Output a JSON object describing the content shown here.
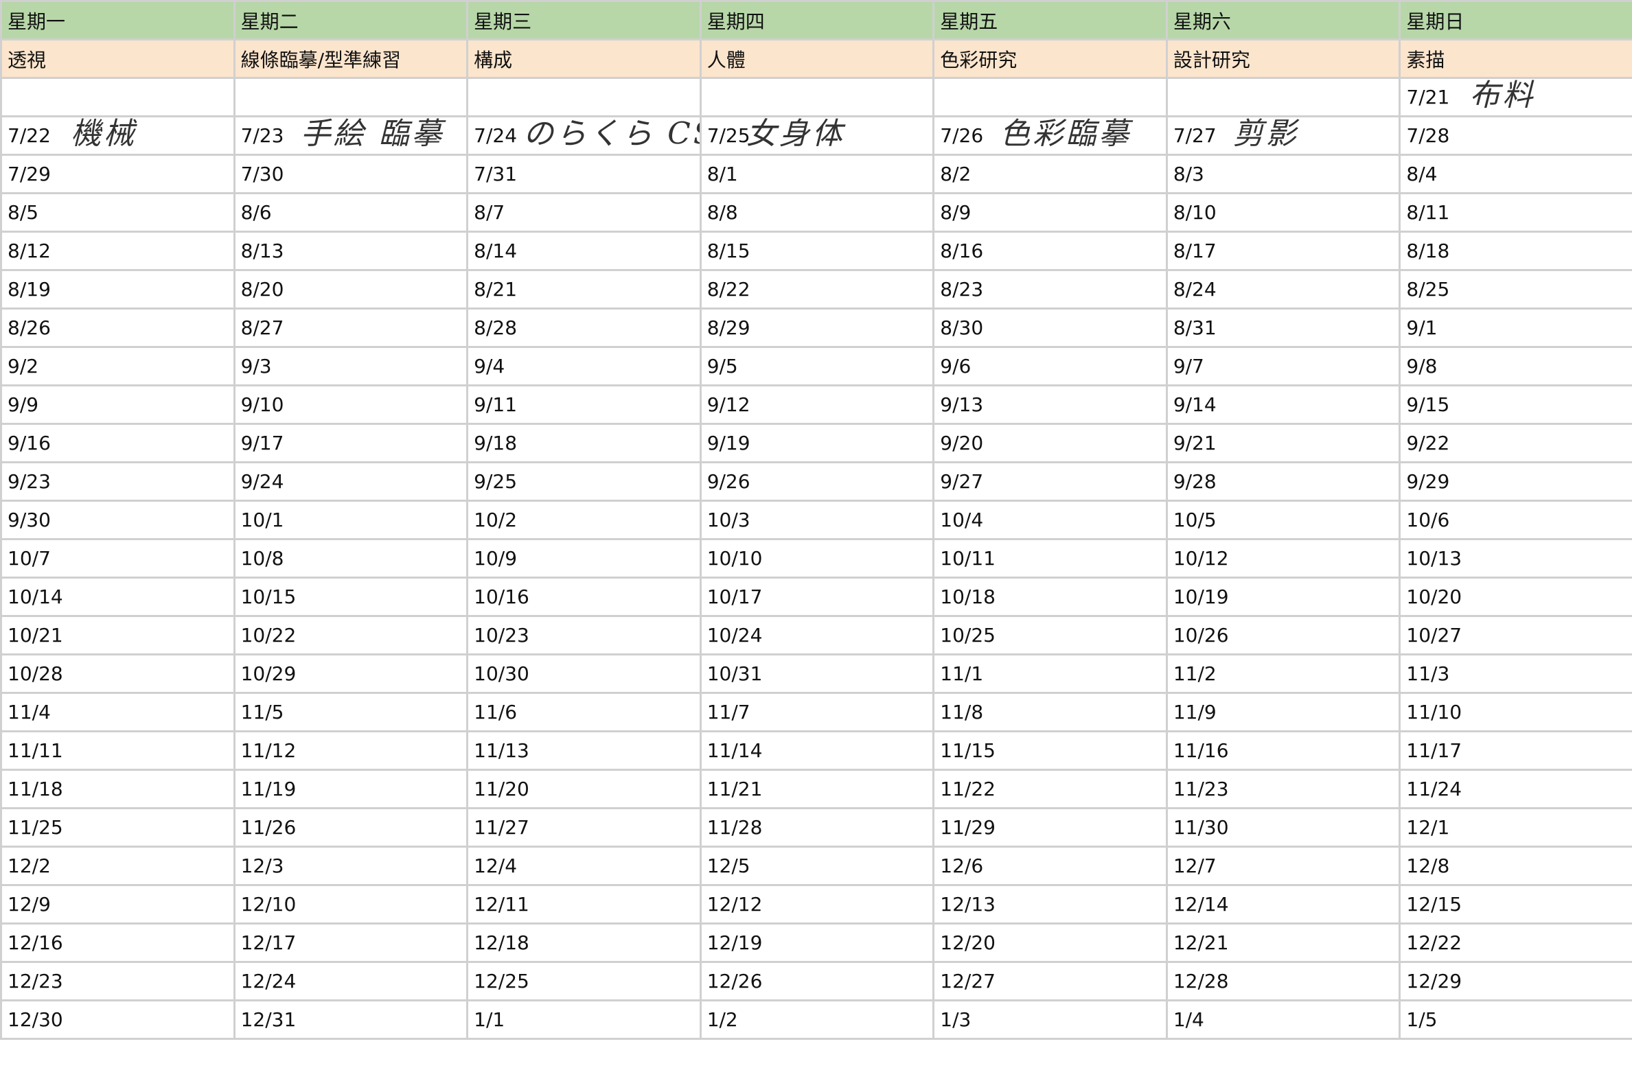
{
  "weekdays": [
    "星期一",
    "星期二",
    "星期三",
    "星期四",
    "星期五",
    "星期六",
    "星期日"
  ],
  "subjects": [
    "透視",
    "線條臨摹/型準練習",
    "構成",
    "人體",
    "色彩研究",
    "設計研究",
    "素描"
  ],
  "rows": [
    [
      "",
      "",
      "",
      "",
      "",
      "",
      "7/21"
    ],
    [
      "7/22",
      "7/23",
      "7/24",
      "7/25",
      "7/26",
      "7/27",
      "7/28"
    ],
    [
      "7/29",
      "7/30",
      "7/31",
      "8/1",
      "8/2",
      "8/3",
      "8/4"
    ],
    [
      "8/5",
      "8/6",
      "8/7",
      "8/8",
      "8/9",
      "8/10",
      "8/11"
    ],
    [
      "8/12",
      "8/13",
      "8/14",
      "8/15",
      "8/16",
      "8/17",
      "8/18"
    ],
    [
      "8/19",
      "8/20",
      "8/21",
      "8/22",
      "8/23",
      "8/24",
      "8/25"
    ],
    [
      "8/26",
      "8/27",
      "8/28",
      "8/29",
      "8/30",
      "8/31",
      "9/1"
    ],
    [
      "9/2",
      "9/3",
      "9/4",
      "9/5",
      "9/6",
      "9/7",
      "9/8"
    ],
    [
      "9/9",
      "9/10",
      "9/11",
      "9/12",
      "9/13",
      "9/14",
      "9/15"
    ],
    [
      "9/16",
      "9/17",
      "9/18",
      "9/19",
      "9/20",
      "9/21",
      "9/22"
    ],
    [
      "9/23",
      "9/24",
      "9/25",
      "9/26",
      "9/27",
      "9/28",
      "9/29"
    ],
    [
      "9/30",
      "10/1",
      "10/2",
      "10/3",
      "10/4",
      "10/5",
      "10/6"
    ],
    [
      "10/7",
      "10/8",
      "10/9",
      "10/10",
      "10/11",
      "10/12",
      "10/13"
    ],
    [
      "10/14",
      "10/15",
      "10/16",
      "10/17",
      "10/18",
      "10/19",
      "10/20"
    ],
    [
      "10/21",
      "10/22",
      "10/23",
      "10/24",
      "10/25",
      "10/26",
      "10/27"
    ],
    [
      "10/28",
      "10/29",
      "10/30",
      "10/31",
      "11/1",
      "11/2",
      "11/3"
    ],
    [
      "11/4",
      "11/5",
      "11/6",
      "11/7",
      "11/8",
      "11/9",
      "11/10"
    ],
    [
      "11/11",
      "11/12",
      "11/13",
      "11/14",
      "11/15",
      "11/16",
      "11/17"
    ],
    [
      "11/18",
      "11/19",
      "11/20",
      "11/21",
      "11/22",
      "11/23",
      "11/24"
    ],
    [
      "11/25",
      "11/26",
      "11/27",
      "11/28",
      "11/29",
      "11/30",
      "12/1"
    ],
    [
      "12/2",
      "12/3",
      "12/4",
      "12/5",
      "12/6",
      "12/7",
      "12/8"
    ],
    [
      "12/9",
      "12/10",
      "12/11",
      "12/12",
      "12/13",
      "12/14",
      "12/15"
    ],
    [
      "12/16",
      "12/17",
      "12/18",
      "12/19",
      "12/20",
      "12/21",
      "12/22"
    ],
    [
      "12/23",
      "12/24",
      "12/25",
      "12/26",
      "12/27",
      "12/28",
      "12/29"
    ],
    [
      "12/30",
      "12/31",
      "1/1",
      "1/2",
      "1/3",
      "1/4",
      "1/5"
    ]
  ],
  "handwritten": [
    {
      "row": 0,
      "col": 6,
      "text": "布料"
    },
    {
      "row": 1,
      "col": 0,
      "text": "機械"
    },
    {
      "row": 1,
      "col": 1,
      "text": "手絵 臨摹"
    },
    {
      "row": 1,
      "col": 2,
      "text": "のらくら CSI"
    },
    {
      "row": 1,
      "col": 3,
      "text": "女身体"
    },
    {
      "row": 1,
      "col": 4,
      "text": "色彩臨摹"
    },
    {
      "row": 1,
      "col": 5,
      "text": "剪影"
    }
  ],
  "colors": {
    "header_bg": "#b7d7a8",
    "subject_bg": "#fce5cd",
    "grid_line": "#d0d0d0"
  }
}
